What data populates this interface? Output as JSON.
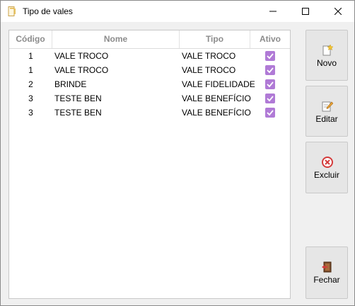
{
  "window": {
    "title": "Tipo de vales"
  },
  "grid": {
    "headers": {
      "codigo": "Código",
      "nome": "Nome",
      "tipo": "Tipo",
      "ativo": "Ativo"
    },
    "rows": [
      {
        "codigo": "1",
        "nome": "VALE TROCO",
        "tipo": "VALE TROCO",
        "ativo": true
      },
      {
        "codigo": "1",
        "nome": "VALE TROCO",
        "tipo": "VALE TROCO",
        "ativo": true
      },
      {
        "codigo": "2",
        "nome": "BRINDE",
        "tipo": "VALE FIDELIDADE",
        "ativo": true
      },
      {
        "codigo": "3",
        "nome": "TESTE BEN",
        "tipo": "VALE BENEFÍCIO",
        "ativo": true
      },
      {
        "codigo": "3",
        "nome": "TESTE BEN",
        "tipo": "VALE BENEFÍCIO",
        "ativo": true
      }
    ]
  },
  "actions": {
    "novo": "Novo",
    "editar": "Editar",
    "excluir": "Excluir",
    "fechar": "Fechar"
  },
  "icons": {
    "app": "document-icon",
    "novo": "new-document-icon",
    "editar": "edit-pencil-icon",
    "excluir": "delete-x-icon",
    "fechar": "exit-door-icon"
  },
  "colors": {
    "checkbox": "#b07ad6",
    "delete": "#d43b3b"
  }
}
